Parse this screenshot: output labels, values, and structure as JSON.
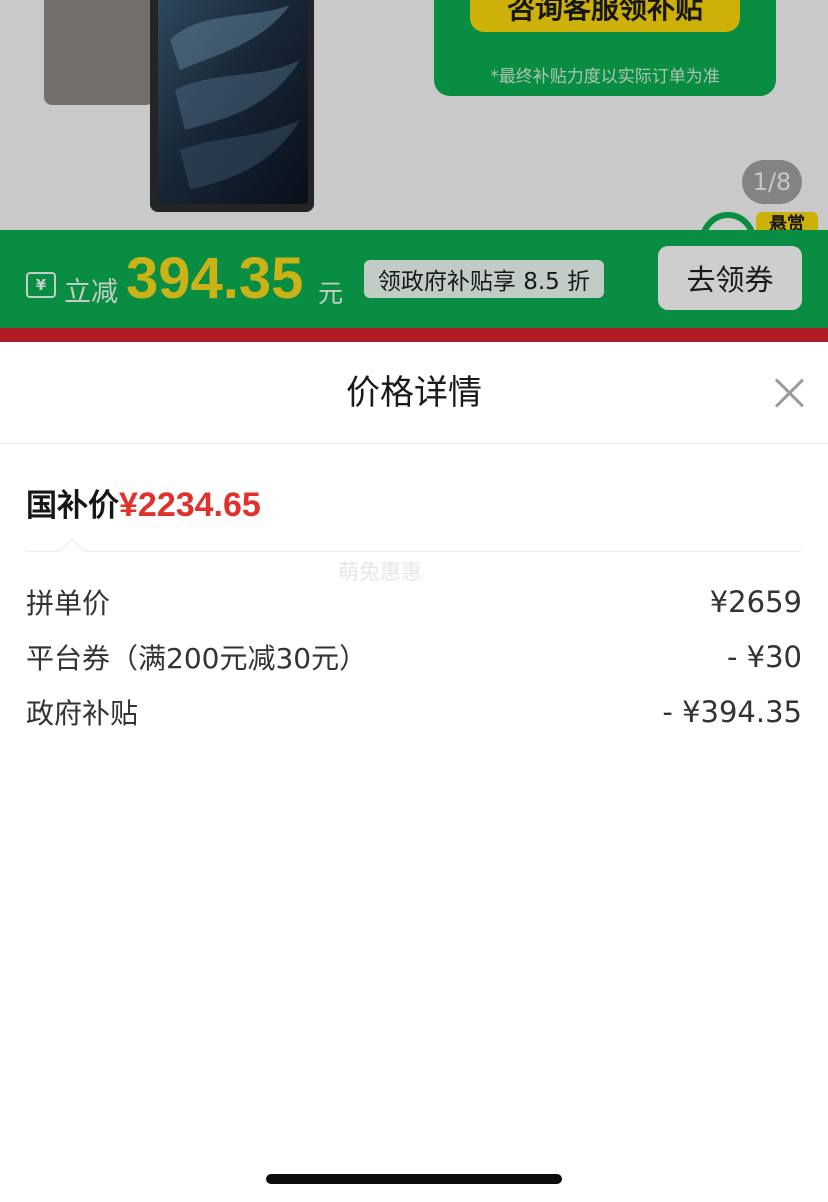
{
  "background": {
    "promo_button_label": "咨询客服领补贴",
    "promo_note": "*最终补贴力度以实际订单为准",
    "image_pager": "1/8",
    "corner_tag": "悬赏",
    "subsidy_bar": {
      "ticket_icon": "¥",
      "reduce_label": "立减",
      "reduce_amount": "394.35",
      "reduce_unit": "元",
      "discount_tag": "领政府补贴享 8.5 折",
      "coupon_button": "去领券"
    },
    "colors": {
      "green": "#0aa84f",
      "yellow": "#f5d20a",
      "red_strip": "#d2222a"
    }
  },
  "sheet": {
    "title": "价格详情",
    "close_icon": "close-icon",
    "final_price": {
      "label": "国补价",
      "value": "¥2234.65",
      "color": "#e0312c"
    },
    "watermark": "萌兔惠惠",
    "items": [
      {
        "label": "拼单价",
        "value": "¥2659"
      },
      {
        "label": "平台券（满200元减30元）",
        "value": "- ¥30"
      },
      {
        "label": "政府补贴",
        "value": "- ¥394.35"
      }
    ]
  }
}
